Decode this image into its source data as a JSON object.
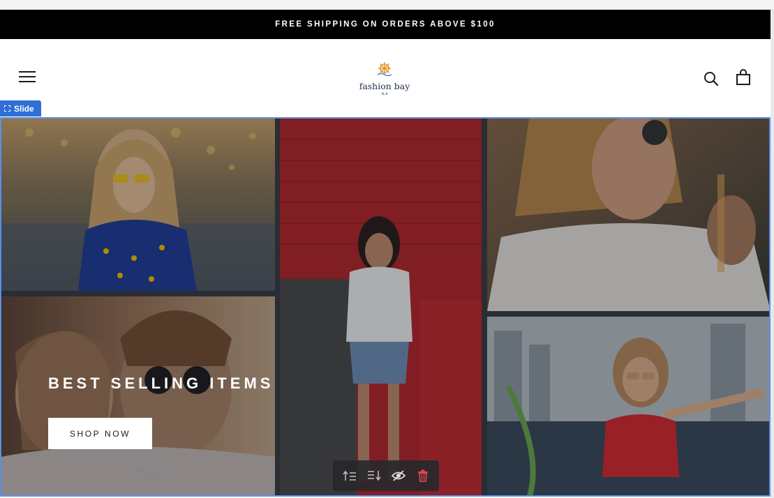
{
  "announcement": {
    "text": "FREE SHIPPING ON ORDERS ABOVE $100"
  },
  "header": {
    "menu_icon": "hamburger-menu-icon",
    "logo": {
      "name": "fashion bay",
      "sub": "u.s",
      "icon": "ship-wheel-icon"
    },
    "search_icon": "search-icon",
    "cart_icon": "shopping-bag-icon"
  },
  "editor": {
    "slide_badge": "Slide"
  },
  "slide": {
    "headline": "BEST SELLING ITEMS",
    "button_label": "SHOP NOW"
  },
  "toolbar": {
    "items": [
      "move-up-icon",
      "move-down-icon",
      "hide-icon",
      "delete-icon"
    ]
  },
  "colors": {
    "accent": "#2f6fd6",
    "delete": "#e04848",
    "announcement_bg": "#000000"
  }
}
